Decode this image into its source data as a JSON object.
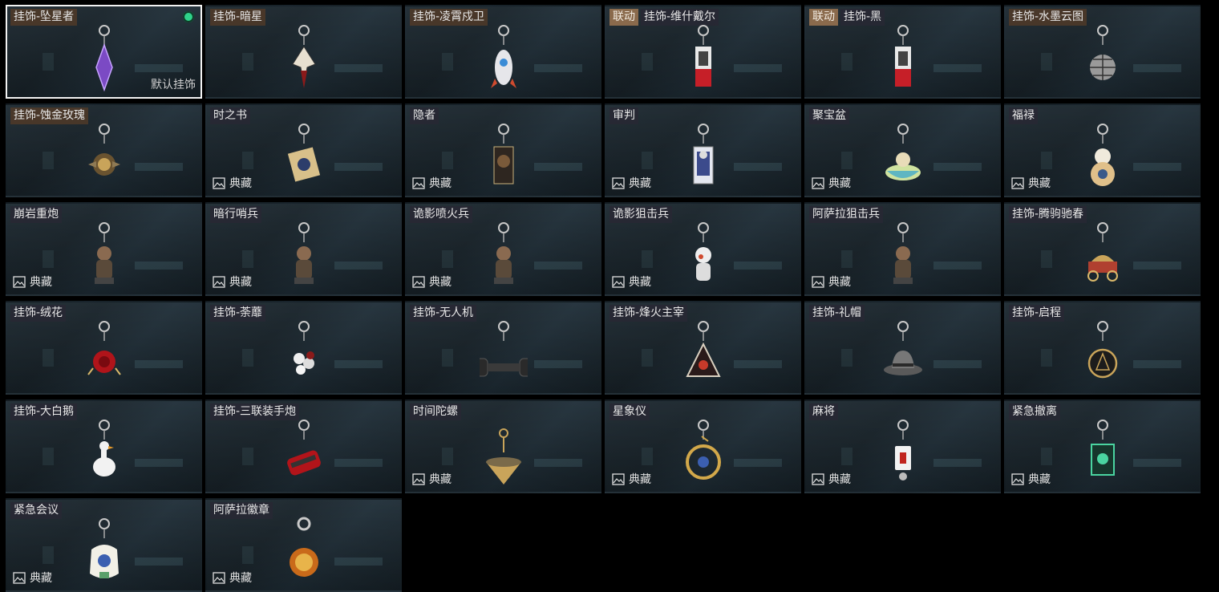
{
  "default_label": "默认挂饰",
  "collection_label": "典藏",
  "colors": {
    "selected_dot": "#2fd28a",
    "tag_bg": "#8a6a4c"
  },
  "items": [
    {
      "tag": "",
      "name": "挂饰-坠星者",
      "selected": true,
      "default": true,
      "collection": false,
      "charm": "purple-crystal",
      "gold": true
    },
    {
      "tag": "",
      "name": "挂饰-暗星",
      "collection": false,
      "charm": "dark-star",
      "gold": true
    },
    {
      "tag": "",
      "name": "挂饰-凌霄戍卫",
      "collection": false,
      "charm": "rocket",
      "gold": true
    },
    {
      "tag": "联动",
      "name": "挂饰-维什戴尔",
      "collection": false,
      "charm": "red-card",
      "gold": false
    },
    {
      "tag": "联动",
      "name": "挂饰-黑",
      "collection": false,
      "charm": "red-card",
      "gold": false
    },
    {
      "tag": "",
      "name": "挂饰-水墨云图",
      "collection": false,
      "charm": "disco-ball",
      "gold": true
    },
    {
      "tag": "",
      "name": "挂饰-蚀金玫瑰",
      "collection": false,
      "charm": "gold-rose",
      "gold": true
    },
    {
      "tag": "",
      "name": "时之书",
      "collection": true,
      "charm": "book",
      "gold": false
    },
    {
      "tag": "",
      "name": "隐者",
      "collection": true,
      "charm": "tarot",
      "gold": false
    },
    {
      "tag": "",
      "name": "审判",
      "collection": true,
      "charm": "tarot-blue",
      "gold": false
    },
    {
      "tag": "",
      "name": "聚宝盆",
      "collection": true,
      "charm": "treasure-bowl",
      "gold": false
    },
    {
      "tag": "",
      "name": "福禄",
      "collection": true,
      "charm": "gourd",
      "gold": false
    },
    {
      "tag": "",
      "name": "崩岩重炮",
      "collection": true,
      "charm": "figure",
      "gold": false
    },
    {
      "tag": "",
      "name": "暗行哨兵",
      "collection": true,
      "charm": "figure",
      "gold": false
    },
    {
      "tag": "",
      "name": "诡影喷火兵",
      "collection": true,
      "charm": "figure",
      "gold": false
    },
    {
      "tag": "",
      "name": "诡影狙击兵",
      "collection": true,
      "charm": "figure-white",
      "gold": false
    },
    {
      "tag": "",
      "name": "阿萨拉狙击兵",
      "collection": true,
      "charm": "figure",
      "gold": false
    },
    {
      "tag": "",
      "name": "挂饰-腾驹驰春",
      "collection": false,
      "charm": "carriage",
      "gold": false
    },
    {
      "tag": "",
      "name": "挂饰-绒花",
      "collection": false,
      "charm": "red-rose",
      "gold": false
    },
    {
      "tag": "",
      "name": "挂饰-荼蘼",
      "collection": false,
      "charm": "white-flower",
      "gold": false
    },
    {
      "tag": "",
      "name": "挂饰-无人机",
      "collection": false,
      "charm": "drone",
      "gold": false
    },
    {
      "tag": "",
      "name": "挂饰-烽火主宰",
      "collection": false,
      "charm": "triangle",
      "gold": false
    },
    {
      "tag": "",
      "name": "挂饰-礼帽",
      "collection": false,
      "charm": "hat",
      "gold": false
    },
    {
      "tag": "",
      "name": "挂饰-启程",
      "collection": false,
      "charm": "compass",
      "gold": false
    },
    {
      "tag": "",
      "name": "挂饰-大白鹅",
      "collection": false,
      "charm": "goose",
      "gold": false
    },
    {
      "tag": "",
      "name": "挂饰-三联装手炮",
      "collection": false,
      "charm": "cannon",
      "gold": false
    },
    {
      "tag": "",
      "name": "时间陀螺",
      "collection": true,
      "charm": "spinning-top",
      "gold": false
    },
    {
      "tag": "",
      "name": "星象仪",
      "collection": true,
      "charm": "astrolabe",
      "gold": false
    },
    {
      "tag": "",
      "name": "麻将",
      "collection": true,
      "charm": "mahjong",
      "gold": false
    },
    {
      "tag": "",
      "name": "紧急撤离",
      "collection": true,
      "charm": "green-sign",
      "gold": false
    },
    {
      "tag": "",
      "name": "紧急会议",
      "collection": true,
      "charm": "sticker",
      "gold": false
    },
    {
      "tag": "",
      "name": "阿萨拉徽章",
      "collection": true,
      "charm": "medal",
      "gold": false
    }
  ]
}
